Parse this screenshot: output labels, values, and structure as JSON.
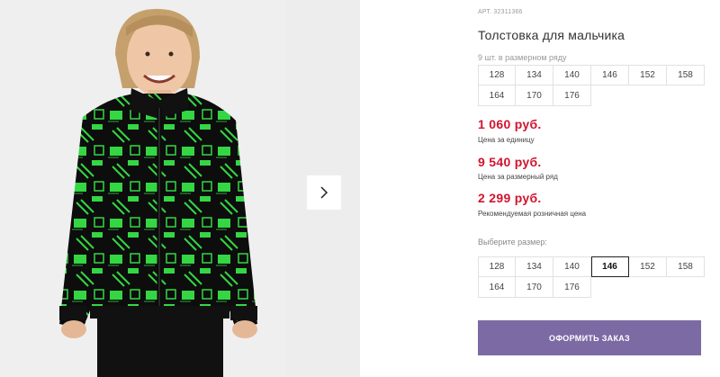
{
  "product": {
    "sku": "АРТ. 32311366",
    "title": "Толстовка для мальчика",
    "pack_note": "9 шт. в размерном ряду",
    "pack_sizes": [
      "128",
      "134",
      "140",
      "146",
      "152",
      "158",
      "164",
      "170",
      "176"
    ],
    "prices": [
      {
        "value": "1 060 руб.",
        "caption": "Цена за единицу"
      },
      {
        "value": "9 540 руб.",
        "caption": "Цена за размерный ряд"
      },
      {
        "value": "2 299 руб.",
        "caption": "Рекомендуемая розничная цена"
      }
    ],
    "choose_label": "Выберите размер:",
    "select_sizes": [
      "128",
      "134",
      "140",
      "146",
      "152",
      "158",
      "164",
      "170",
      "176"
    ],
    "selected_size": "146",
    "order_button": "ОФОРМИТЬ ЗАКАЗ"
  },
  "colors": {
    "price": "#d2142e",
    "accent": "#7c6aa4",
    "fleece_green": "#3dd64a"
  },
  "icons": {
    "next": "chevron-right-icon"
  }
}
